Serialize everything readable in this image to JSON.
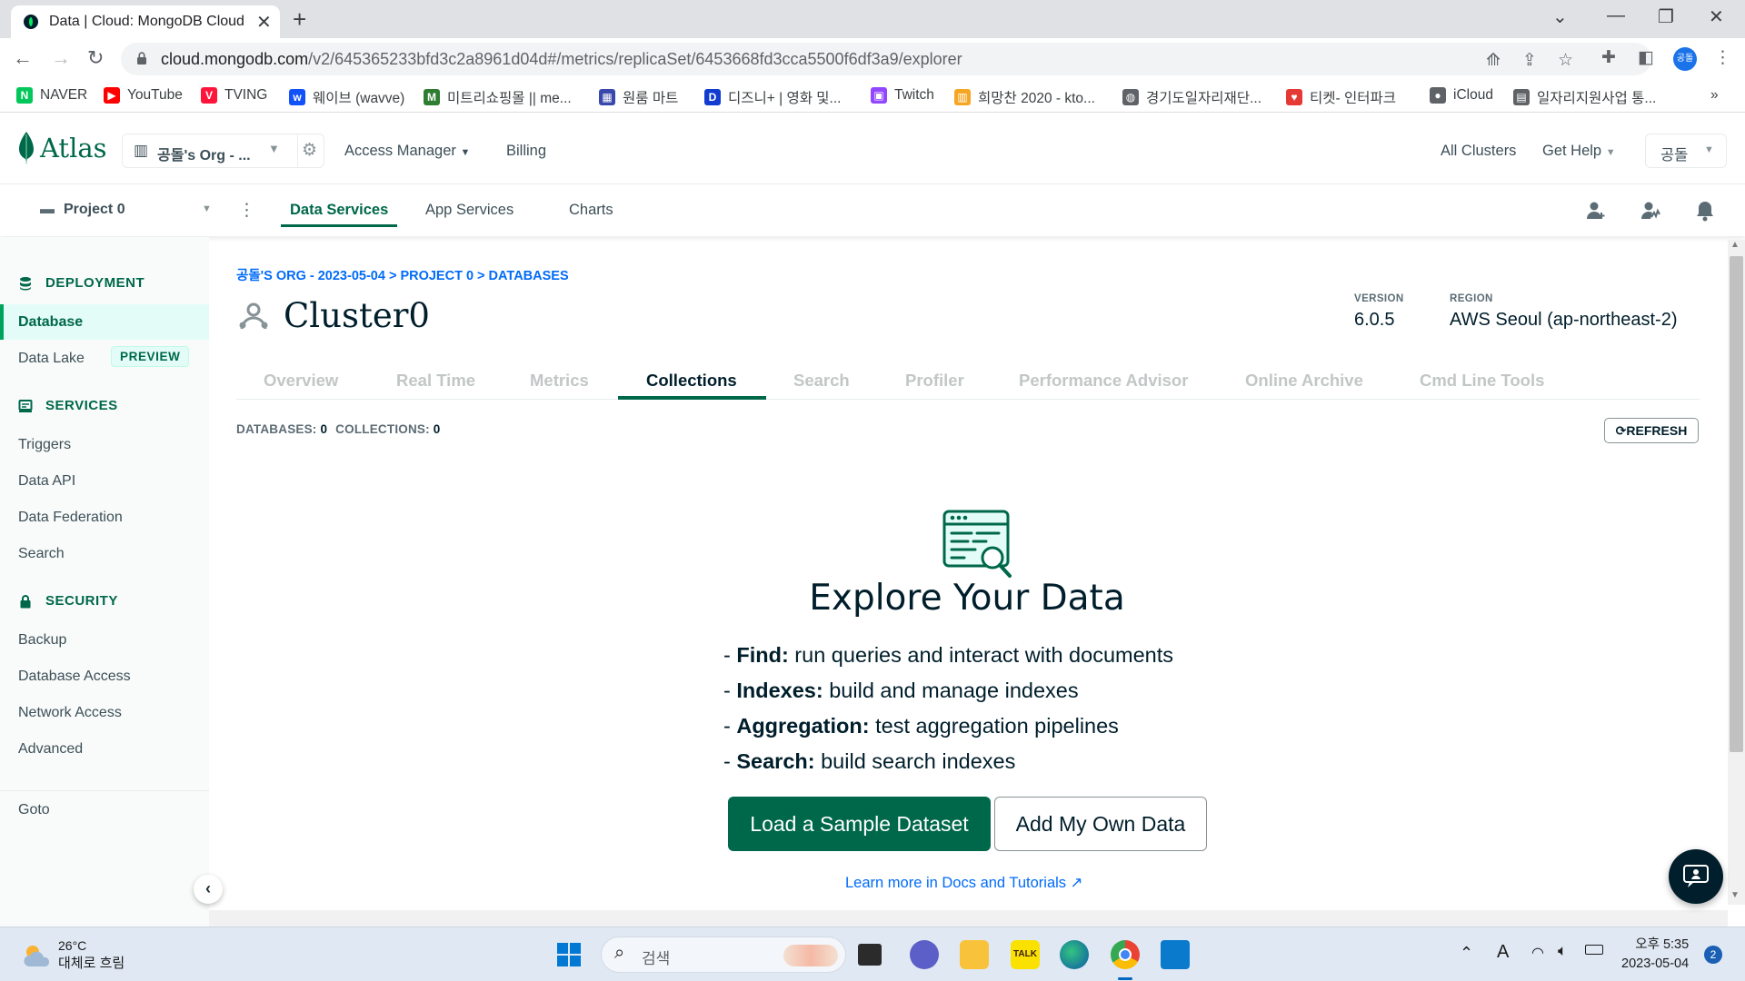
{
  "browser": {
    "tab_title": "Data | Cloud: MongoDB Cloud",
    "url_host": "cloud.mongodb.com",
    "url_path": "/v2/645365233bfd3c2a8961d04d#/metrics/replicaSet/6453668fd3cca5500f6df3a9/explorer",
    "profile": "공돌",
    "bookmarks": [
      {
        "label": "NAVER",
        "icon": "naver-icon",
        "color": "#03c75a",
        "glyph": "N"
      },
      {
        "label": "YouTube",
        "icon": "youtube-icon",
        "color": "#ff0000",
        "glyph": "▶"
      },
      {
        "label": "TVING",
        "icon": "tving-icon",
        "color": "#ff153c",
        "glyph": "V"
      },
      {
        "label": "웨이브 (wavve)",
        "icon": "wavve-icon",
        "color": "#1351f9",
        "glyph": "w"
      },
      {
        "label": "미트리쇼핑몰 || me...",
        "icon": "mitri-icon",
        "color": "#2e7d32",
        "glyph": "M"
      },
      {
        "label": "원룸 마트",
        "icon": "oneroom-icon",
        "color": "#3949ab",
        "glyph": "▦"
      },
      {
        "label": "디즈니+ | 영화 및...",
        "icon": "disney-icon",
        "color": "#113ccf",
        "glyph": "D"
      },
      {
        "label": "Twitch",
        "icon": "twitch-icon",
        "color": "#9146ff",
        "glyph": "▣"
      },
      {
        "label": "희망찬 2020 - kto...",
        "icon": "hope-icon",
        "color": "#f5a623",
        "glyph": "▥"
      },
      {
        "label": "경기도일자리재단...",
        "icon": "globe-icon",
        "color": "#5f6368",
        "glyph": "◍"
      },
      {
        "label": "티켓- 인터파크",
        "icon": "heart-icon",
        "color": "#e53935",
        "glyph": "♥"
      },
      {
        "label": "iCloud",
        "icon": "apple-icon",
        "color": "#5f6368",
        "glyph": "●"
      },
      {
        "label": "일자리지원사업 통...",
        "icon": "clipboard-icon",
        "color": "#5f6368",
        "glyph": "▤"
      }
    ],
    "bookmarks_more": "»"
  },
  "atlas": {
    "logo_text": "Atlas",
    "org": "공돌's Org - ...",
    "access_manager": "Access Manager",
    "billing": "Billing",
    "all_clusters": "All Clusters",
    "get_help": "Get Help",
    "user": "공돌",
    "project": "Project 0",
    "product_tabs": [
      "Data Services",
      "App Services",
      "Charts"
    ],
    "accent": "#00684a"
  },
  "sidebar": {
    "deployment": {
      "title": "DEPLOYMENT",
      "items": [
        "Database",
        "Data Lake"
      ],
      "badge": "PREVIEW"
    },
    "services": {
      "title": "SERVICES",
      "items": [
        "Triggers",
        "Data API",
        "Data Federation",
        "Search"
      ]
    },
    "security": {
      "title": "SECURITY",
      "items": [
        "Backup",
        "Database Access",
        "Network Access",
        "Advanced"
      ]
    },
    "goto": "Goto"
  },
  "main": {
    "breadcrumb": "공돌'S ORG - 2023-05-04 > PROJECT 0 > DATABASES",
    "cluster_name": "Cluster0",
    "version_label": "VERSION",
    "version": "6.0.5",
    "region_label": "REGION",
    "region": "AWS Seoul (ap-northeast-2)",
    "tabs": [
      "Overview",
      "Real Time",
      "Metrics",
      "Collections",
      "Search",
      "Profiler",
      "Performance Advisor",
      "Online Archive",
      "Cmd Line Tools"
    ],
    "active_tab": "Collections",
    "databases_label": "DATABASES:",
    "databases_count": "0",
    "collections_label": "COLLECTIONS:",
    "collections_count": "0",
    "refresh": "REFRESH",
    "empty": {
      "title": "Explore Your Data",
      "features": [
        {
          "name": "Find:",
          "desc": " run queries and interact with documents"
        },
        {
          "name": "Indexes:",
          "desc": " build and manage indexes"
        },
        {
          "name": "Aggregation:",
          "desc": " test aggregation pipelines"
        },
        {
          "name": "Search:",
          "desc": " build search indexes"
        }
      ],
      "primary_button": "Load a Sample Dataset",
      "secondary_button": "Add My Own Data",
      "learn_more": "Learn more in Docs and Tutorials"
    }
  },
  "taskbar": {
    "temp": "26°C",
    "weather": "대체로 흐림",
    "search_placeholder": "검색",
    "time": "오후 5:35",
    "date": "2023-05-04",
    "notifications": "2"
  }
}
